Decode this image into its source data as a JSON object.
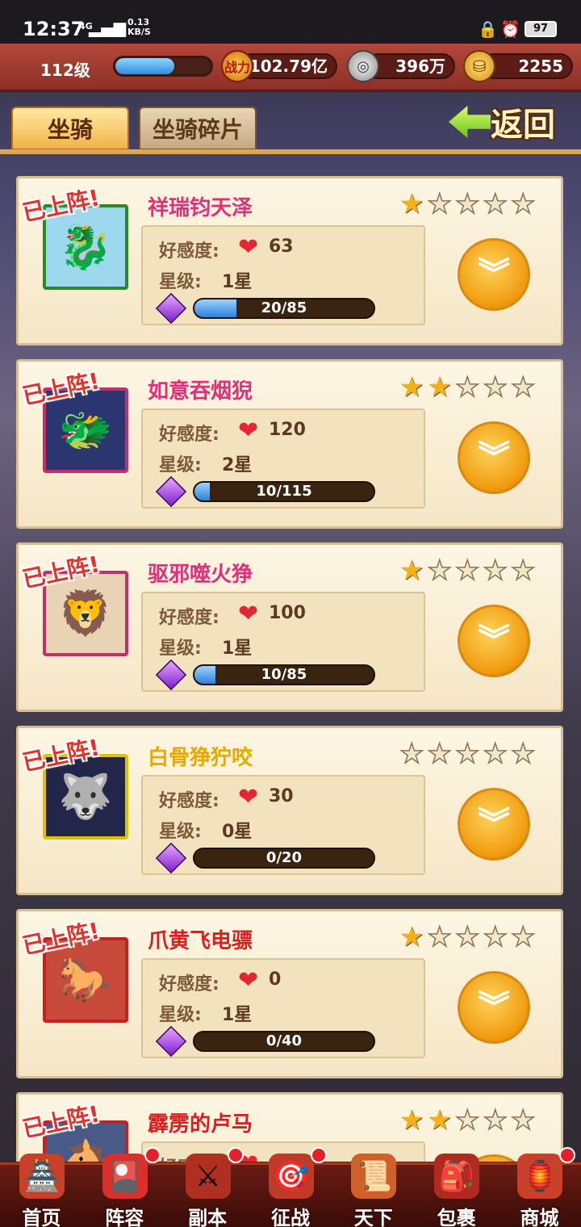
{
  "status_bar": {
    "time": "12:37",
    "network": "4G",
    "speed_top": "0.13",
    "speed_bottom": "KB/S",
    "battery": "97"
  },
  "resources": {
    "level": "112级",
    "xp_fraction": 0.62,
    "power_icon_text": "战力",
    "power": "102.79亿",
    "coins": "396万",
    "ingots": "2255"
  },
  "tabs": [
    {
      "label": "坐骑",
      "active": true
    },
    {
      "label": "坐骑碎片",
      "active": false
    }
  ],
  "back_label": "返回",
  "deployed_label": "已上阵!",
  "affection_label": "好感度:",
  "star_level_label": "星级:",
  "mounts": [
    {
      "name": "祥瑞钧天泽",
      "name_color": "#e0307a",
      "stars": 1,
      "affection": "63",
      "star_text": "1星",
      "progress": "20/85",
      "fill": 0.235,
      "frame": "#2a8a2a",
      "portrait_bg": "#9ed8ee",
      "portrait_glyph": "🐉",
      "deployed": true
    },
    {
      "name": "如意吞烟猊",
      "name_color": "#e0307a",
      "stars": 2,
      "affection": "120",
      "star_text": "2星",
      "progress": "10/115",
      "fill": 0.087,
      "frame": "#c0306a",
      "portrait_bg": "#2b3670",
      "portrait_glyph": "🐲",
      "deployed": true
    },
    {
      "name": "驱邪噬火狰",
      "name_color": "#e0307a",
      "stars": 1,
      "affection": "100",
      "star_text": "1星",
      "progress": "10/85",
      "fill": 0.118,
      "frame": "#c0306a",
      "portrait_bg": "#e8d4b4",
      "portrait_glyph": "🦁",
      "deployed": true
    },
    {
      "name": "白骨狰狞咬",
      "name_color": "#e8a800",
      "stars": 0,
      "affection": "30",
      "star_text": "0星",
      "progress": "0/20",
      "fill": 0.0,
      "frame": "#e0c000",
      "portrait_bg": "#22264a",
      "portrait_glyph": "🐺",
      "deployed": true
    },
    {
      "name": "爪黄飞电骠",
      "name_color": "#d82020",
      "stars": 1,
      "affection": "0",
      "star_text": "1星",
      "progress": "0/40",
      "fill": 0.0,
      "frame": "#c82020",
      "portrait_bg": "#c84a3a",
      "portrait_glyph": "🐎",
      "deployed": true
    },
    {
      "name": "霹雳的卢马",
      "name_color": "#d82020",
      "stars": 2,
      "affection": "",
      "star_text": "",
      "progress": "",
      "fill": 0.0,
      "frame": "#c82020",
      "portrait_bg": "#4a5a88",
      "portrait_glyph": "🐴",
      "deployed": true
    }
  ],
  "bottom_nav": [
    {
      "label": "首页",
      "icon": "home-icon",
      "glyph": "🏯",
      "badge": false
    },
    {
      "label": "阵容",
      "icon": "lineup-icon",
      "glyph": "🎴",
      "badge": true
    },
    {
      "label": "副本",
      "icon": "dungeon-icon",
      "glyph": "⚔",
      "badge": true
    },
    {
      "label": "征战",
      "icon": "campaign-icon",
      "glyph": "🎯",
      "badge": true
    },
    {
      "label": "天下",
      "icon": "world-icon",
      "glyph": "📜",
      "badge": false
    },
    {
      "label": "包裹",
      "icon": "bag-icon",
      "glyph": "🎒",
      "badge": false
    },
    {
      "label": "商城",
      "icon": "shop-icon",
      "glyph": "🏮",
      "badge": true
    }
  ]
}
